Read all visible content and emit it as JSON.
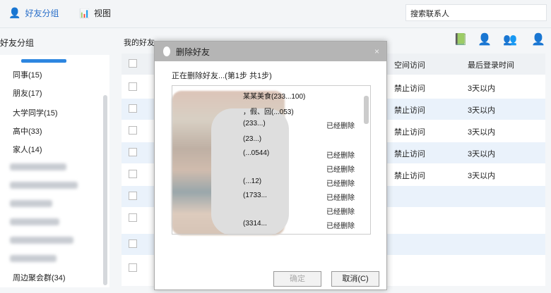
{
  "toolbar": {
    "tab_friends": "好友分组",
    "tab_view": "视图",
    "search_placeholder": "搜索联系人"
  },
  "sidebar": {
    "title": "好友分组",
    "groups": [
      "同事(15)",
      "朋友(17)",
      "大学同学(15)",
      "高中(33)",
      "家人(14)",
      "周边聚会群(34)"
    ]
  },
  "main": {
    "header": "我的好友...",
    "columns": [
      "空间访问",
      "最后登录时间"
    ],
    "rows": [
      [
        "禁止访问",
        "3天以内"
      ],
      [
        "禁止访问",
        "3天以内"
      ],
      [
        "禁止访问",
        "3天以内"
      ],
      [
        "禁止访问",
        "3天以内"
      ],
      [
        "禁止访问",
        "3天以内"
      ]
    ]
  },
  "dialog": {
    "title": "删除好友",
    "progress": "正在删除好友...(第1步 共1步)",
    "items": [
      "某某美食(233...100)",
      "，假、回(...053)",
      "(233...)",
      "(23...)",
      "(...0544)",
      "",
      "(...12)",
      "(1733...",
      "(3314..."
    ],
    "status": "已经删除",
    "ok": "确定",
    "cancel": "取消(C)"
  }
}
